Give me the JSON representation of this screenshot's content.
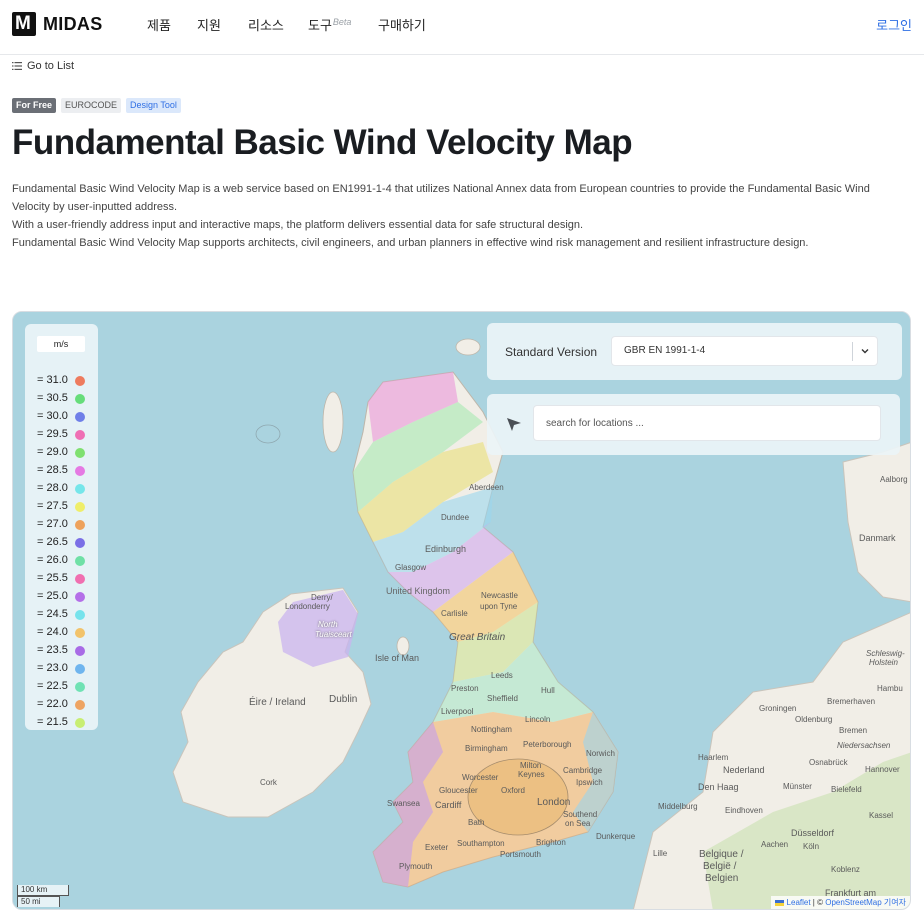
{
  "header": {
    "logo_text": "MIDAS",
    "logo_mark": "M",
    "nav": [
      {
        "label": "제품"
      },
      {
        "label": "지원"
      },
      {
        "label": "리소스"
      },
      {
        "label": "도구",
        "sup": "Beta"
      },
      {
        "label": "구매하기"
      }
    ],
    "login": "로그인"
  },
  "breadcrumb": {
    "go_to_list": "Go to List",
    "icon": "list-icon"
  },
  "badges": [
    "For Free",
    "EUROCODE",
    "Design Tool"
  ],
  "page": {
    "title": "Fundamental Basic Wind Velocity Map",
    "description": [
      "Fundamental Basic Wind Velocity Map is a web service based on EN1991-1-4 that utilizes National Annex data from European countries to provide the Fundamental Basic Wind Velocity by user-inputted address.",
      "With a user-friendly address input and interactive maps, the platform delivers essential data for safe structural design.",
      "Fundamental Basic Wind Velocity Map supports architects, civil engineers, and urban planners in effective wind risk management and resilient infrastructure design."
    ]
  },
  "map": {
    "legend": {
      "unit": "m/s",
      "items": [
        {
          "label": "= 31.0",
          "color": "#ee7b5e"
        },
        {
          "label": "= 30.5",
          "color": "#66dd7a"
        },
        {
          "label": "= 30.0",
          "color": "#6f7fe8"
        },
        {
          "label": "= 29.5",
          "color": "#ef6fb4"
        },
        {
          "label": "= 29.0",
          "color": "#7fe070"
        },
        {
          "label": "= 28.5",
          "color": "#e57ae3"
        },
        {
          "label": "= 28.0",
          "color": "#76e6ea"
        },
        {
          "label": "= 27.5",
          "color": "#efee6a"
        },
        {
          "label": "= 27.0",
          "color": "#eea25c"
        },
        {
          "label": "= 26.5",
          "color": "#7b6fe6"
        },
        {
          "label": "= 26.0",
          "color": "#6fe0a6"
        },
        {
          "label": "= 25.5",
          "color": "#f06fb0"
        },
        {
          "label": "= 25.0",
          "color": "#b46fe8"
        },
        {
          "label": "= 24.5",
          "color": "#76e3ec"
        },
        {
          "label": "= 24.0",
          "color": "#f2c36a"
        },
        {
          "label": "= 23.5",
          "color": "#a86be6"
        },
        {
          "label": "= 23.0",
          "color": "#6fb5ee"
        },
        {
          "label": "= 22.5",
          "color": "#70e2b4"
        },
        {
          "label": "= 22.0",
          "color": "#eea462"
        },
        {
          "label": "= 21.5",
          "color": "#c8ee72"
        }
      ]
    },
    "standard_version": {
      "label": "Standard Version",
      "value": "GBR EN 1991-1-4"
    },
    "search": {
      "placeholder": "search for locations ..."
    },
    "scale": {
      "km": "100 km",
      "mi": "50 mi"
    },
    "attribution": {
      "leaflet": "Leaflet",
      "sep": " | © ",
      "osm": "OpenStreetMap 기여자"
    },
    "labels": {
      "aberdeen": "Aberdeen",
      "dundee": "Dundee",
      "edinburgh": "Edinburgh",
      "glasgow": "Glasgow",
      "united_kingdom": "United Kingdom",
      "newcastle": "Newcastle",
      "upon_tyne": "upon Tyne",
      "carlisle": "Carlisle",
      "great_britain": "Great Britain",
      "isle_of_man": "Isle of Man",
      "leeds": "Leeds",
      "sheffield": "Sheffield",
      "preston": "Preston",
      "hull": "Hull",
      "liverpool": "Liverpool",
      "nottingham": "Nottingham",
      "lincoln": "Lincoln",
      "birmingham": "Birmingham",
      "peterborough": "Peterborough",
      "norwich": "Norwich",
      "milton": "Milton",
      "keynes": "Keynes",
      "cambridge": "Cambridge",
      "ipswich": "Ipswich",
      "worcester": "Worcester",
      "oxford": "Oxford",
      "gloucester": "Gloucester",
      "london": "London",
      "cardiff": "Cardiff",
      "swansea": "Swansea",
      "bath": "Bath",
      "southend": "Southend",
      "on_sea": "on Sea",
      "dunkerque": "Dunkerque",
      "southampton": "Southampton",
      "brighton": "Brighton",
      "portsmouth": "Portsmouth",
      "exeter": "Exeter",
      "plymouth": "Plymouth",
      "derry": "Derry/",
      "londonderry": "Londonderry",
      "north": "North",
      "tuaisceart": "Tuaisceart",
      "eire": "Éire / Ireland",
      "dublin": "Dublin",
      "cork": "Cork",
      "danmark": "Danmark",
      "aalborg": "Aalborg",
      "groningen": "Groningen",
      "oldenburg": "Oldenburg",
      "bremerhaven": "Bremerhaven",
      "bremen": "Bremen",
      "hamburg": "Hambu",
      "nederland": "Nederland",
      "hannover": "Hannover",
      "den_haag": "Den Haag",
      "munster": "Münster",
      "bielefeld": "Bielefeld",
      "kassel": "Kassel",
      "dusseldorf": "Düsseldorf",
      "koln": "Köln",
      "koblenz": "Koblenz",
      "lille": "Lille",
      "belgique": "Belgique /",
      "belgie": "België /",
      "belgien": "Belgien",
      "frankfurt": "Frankfurt am",
      "osnabruck": "Osnabrück",
      "eindhoven": "Eindhoven",
      "middelburg": "Middelburg",
      "haarlem": "Haarlem",
      "schleswig": "Schleswig-",
      "holstein": "Holstein",
      "niedersachsen": "Niedersachsen",
      "aachen": "Aachen"
    }
  }
}
